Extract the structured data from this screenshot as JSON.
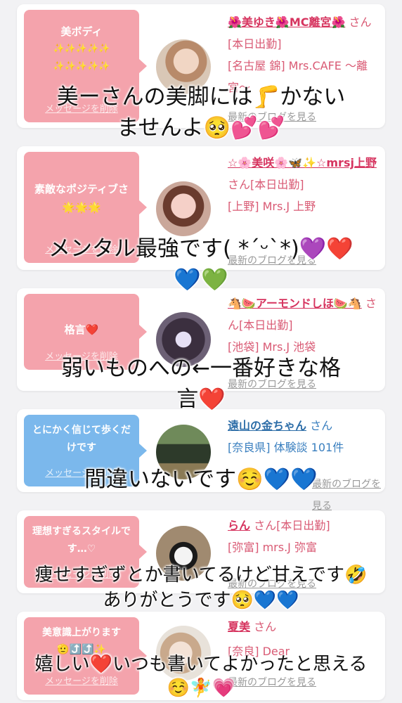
{
  "cards": [
    {
      "bubble_text": "美ボディ",
      "bubble_emoji": "✨✨✨✨✨ ✨✨✨✨✨",
      "delete_label": "メッセージを削除",
      "name": "🌺美ゆき🌺MC離宮🌺",
      "honorific": "さん[本日出勤]",
      "shop": "[名古屋 錦] Mrs.CAFE 〜離宮〜",
      "blog_link": "最新のブログを見る"
    },
    {
      "bubble_text": "素敵なポジティブさ🌟🌟🌟",
      "delete_label": "メッセージを削除",
      "name": "☆🌸美咲🌸🦋✨☆mrsj上野",
      "honorific": "さん[本日出勤]",
      "shop": "[上野] Mrs.J 上野",
      "blog_link": "最新のブログを見る"
    },
    {
      "bubble_text": "格言❤️",
      "delete_label": "メッセージを削除",
      "name": "🐴🍉アーモンドしほ🍉🐴",
      "honorific": "さん[本日出勤]",
      "shop": "[池袋] Mrs.J 池袋",
      "blog_link": "最新のブログを見る"
    },
    {
      "bubble_text": "とにかく信じて歩くだけです",
      "delete_label": "メッセージを削除",
      "name": "遠山の金ちゃん",
      "honorific": "さん",
      "shop": "[奈良県] 体験談 101件",
      "blog_link": "最新のブログを見る"
    },
    {
      "bubble_text": "理想すぎるスタイルです…♡",
      "delete_label": "メッセージを削除",
      "name": "らん",
      "honorific": "さん[本日出勤]",
      "shop": "[弥富] mrs.J 弥富",
      "blog_link": "最新のブログを見る"
    },
    {
      "bubble_text": "美意識上がります",
      "bubble_emoji": "🫡⤴️⤴️✨",
      "delete_label": "メッセージを削除",
      "name": "夏美",
      "honorific": "さん",
      "shop": "[奈良] Dear",
      "blog_link": "最新のブログを見る"
    }
  ],
  "overlays": [
    {
      "line1": "美ーさんの美脚には🦵かない",
      "line2": "ませんよ🥺💕💕"
    },
    {
      "line1": "メンタル最強です( *ˊᵕˋ*)💜❤️",
      "line2": "💙💚"
    },
    {
      "line1": "弱いものへの←一番好きな格",
      "line2": "言❤️"
    },
    {
      "line1": "間違いないです☺️💙💙"
    },
    {
      "line1": "痩せすぎずとか書いてるけど甘えです🤣",
      "line2": "ありがとうです🥺💙💙"
    },
    {
      "line1": "嬉しい❤️いつも書いてよかったと思える",
      "line2": "☺️🧚💗"
    }
  ]
}
